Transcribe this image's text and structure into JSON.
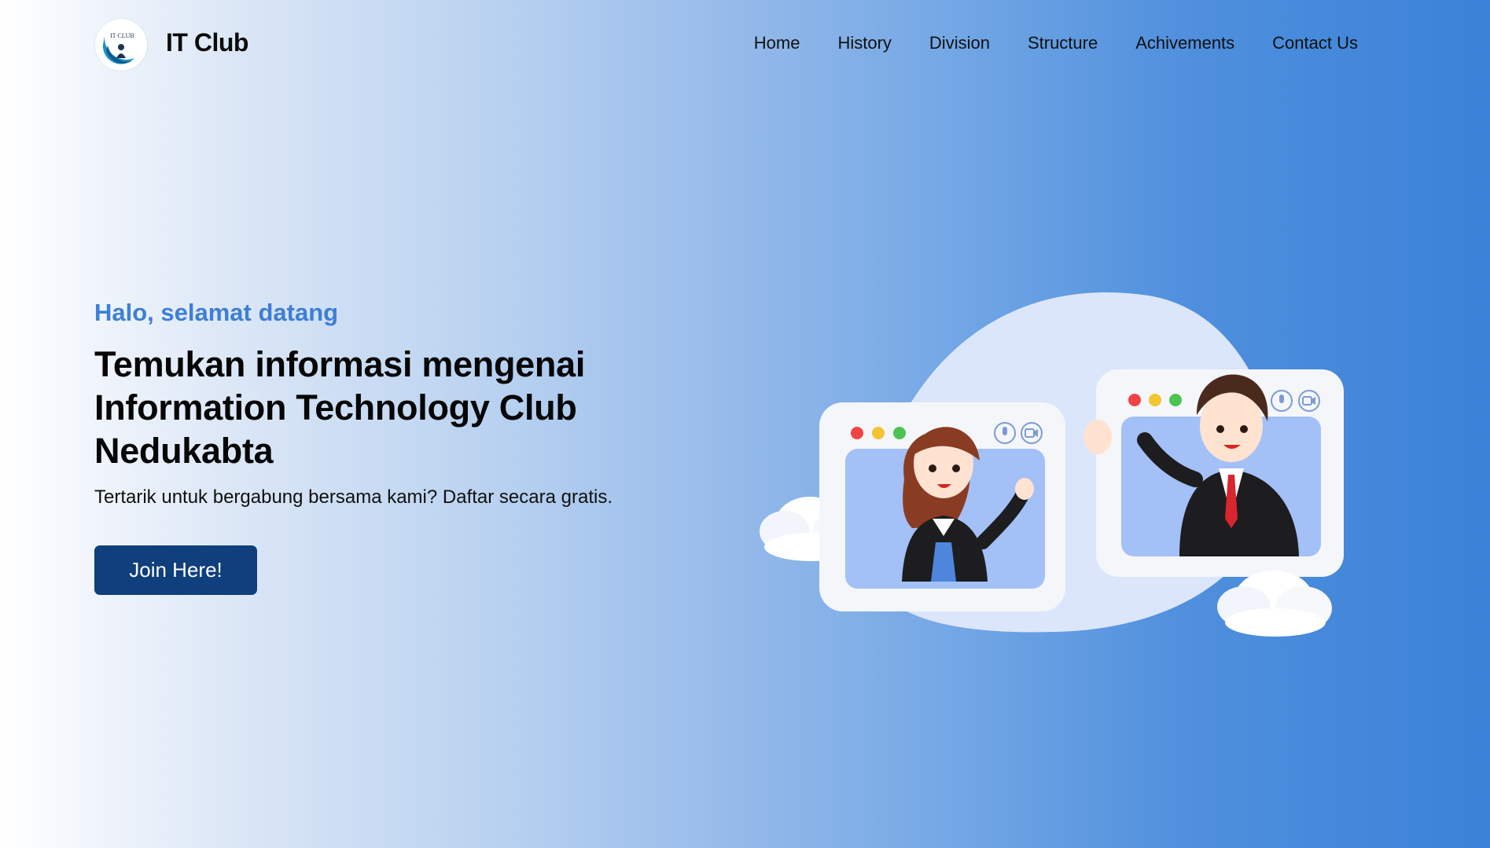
{
  "header": {
    "brand": "IT Club",
    "logo_text": "IT CLUB",
    "nav": [
      "Home",
      "History",
      "Division",
      "Structure",
      "Achivements",
      "Contact Us"
    ]
  },
  "hero": {
    "greeting": "Halo, selamat datang",
    "title": "Temukan informasi mengenai Information Technology Club Nedukabta",
    "subtitle": "Tertarik untuk bergabung bersama kami? Daftar secara gratis.",
    "cta_label": "Join Here!"
  },
  "colors": {
    "accent": "#3d7fd6",
    "button": "#0f3f7c",
    "gradient_start": "#ffffff",
    "gradient_end": "#3b82d8"
  },
  "icons": [
    "logo-icon",
    "microphone-icon",
    "video-camera-icon",
    "cloud-icon"
  ]
}
